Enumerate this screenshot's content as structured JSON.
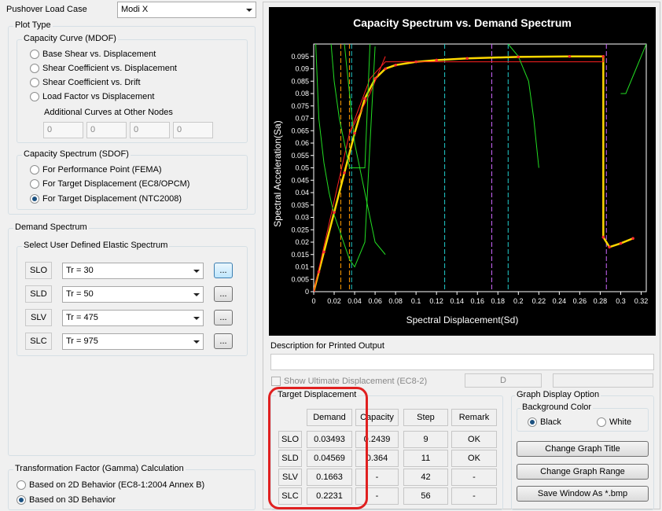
{
  "pushover": {
    "label": "Pushover Load Case",
    "value": "Modi X"
  },
  "plot_type": {
    "title": "Plot Type",
    "mdof": {
      "title": "Capacity Curve (MDOF)",
      "options": [
        "Base Shear vs. Displacement",
        "Shear Coefficient vs. Displacement",
        "Shear Coefficient vs. Drift",
        "Load Factor vs Displacement"
      ],
      "additional_label": "Additional Curves at Other Nodes",
      "nodes": [
        "0",
        "0",
        "0",
        "0"
      ]
    },
    "sdof": {
      "title": "Capacity Spectrum (SDOF)",
      "options": [
        "For Performance Point (FEMA)",
        "For Target Displacement (EC8/OPCM)",
        "For Target Displacement (NTC2008)"
      ],
      "selected_index": 2
    }
  },
  "demand": {
    "title": "Demand Spectrum",
    "subtitle": "Select User Defined Elastic Spectrum",
    "rows": [
      {
        "level": "SLO",
        "value": "Tr = 30",
        "btn": "..."
      },
      {
        "level": "SLD",
        "value": "Tr = 50",
        "btn": "..."
      },
      {
        "level": "SLV",
        "value": "Tr = 475",
        "btn": "..."
      },
      {
        "level": "SLC",
        "value": "Tr = 975",
        "btn": "..."
      }
    ]
  },
  "gamma": {
    "title": "Transformation Factor (Gamma) Calculation",
    "options": [
      "Based on 2D Behavior (EC8-1:2004  Annex B)",
      "Based on 3D Behavior"
    ],
    "selected_index": 1
  },
  "chart_data": {
    "type": "line",
    "title": "Capacity Spectrum vs. Demand Spectrum",
    "xlabel": "Spectral Displacement(Sd)",
    "ylabel": "Spectral Acceleration(Sa)",
    "xlim": [
      0,
      0.325
    ],
    "ylim": [
      0,
      0.1
    ],
    "xticks": [
      "0",
      "0.02",
      "0.04",
      "0.06",
      "0.08",
      "0.1",
      "0.12",
      "0.14",
      "0.16",
      "0.18",
      "0.2",
      "0.22",
      "0.24",
      "0.26",
      "0.28",
      "0.3",
      "0.32"
    ],
    "yticks": [
      "0",
      "0.005",
      "0.01",
      "0.015",
      "0.02",
      "0.025",
      "0.03",
      "0.035",
      "0.04",
      "0.045",
      "0.05",
      "0.055",
      "0.06",
      "0.065",
      "0.07",
      "0.075",
      "0.08",
      "0.085",
      "0.09",
      "0.095"
    ],
    "background": "#000000",
    "series": [
      {
        "color": "#ffd700",
        "x": [
          0,
          0.005,
          0.01,
          0.02,
          0.03,
          0.04,
          0.05,
          0.06,
          0.07,
          0.08,
          0.1,
          0.12,
          0.15,
          0.2,
          0.25,
          0.283,
          0.283,
          0.289,
          0.3,
          0.312
        ],
        "y": [
          0,
          0.008,
          0.016,
          0.032,
          0.048,
          0.064,
          0.078,
          0.086,
          0.09,
          0.0915,
          0.0928,
          0.0935,
          0.0942,
          0.0948,
          0.095,
          0.095,
          0.022,
          0.018,
          0.0195,
          0.0215
        ]
      },
      {
        "color": "#ff2020",
        "x": [
          0,
          0.035,
          0.055,
          0.07,
          0.283,
          0.283
        ],
        "y": [
          0,
          0.064,
          0.086,
          0.0928,
          0.0928,
          0.095
        ]
      },
      {
        "color": "#ff2020",
        "x": [
          0.035,
          0.055,
          0.07
        ],
        "y": [
          0.064,
          0.08,
          0.095
        ]
      },
      {
        "color": "#22dd22",
        "x": [
          0.002,
          0.005,
          0.01,
          0.015,
          0.02,
          0.025,
          0.03,
          0.035,
          0.04,
          0.05,
          0.06
        ],
        "y": [
          0.1,
          0.07,
          0.052,
          0.04,
          0.031,
          0.025,
          0.019,
          0.013,
          0.01,
          0.02,
          0.099
        ]
      },
      {
        "color": "#22dd22",
        "x": [
          0.017,
          0.02,
          0.025,
          0.03,
          0.035,
          0.04,
          0.05,
          0.055
        ],
        "y": [
          0.1,
          0.085,
          0.07,
          0.06,
          0.05,
          0.05,
          0.05,
          0.1
        ]
      },
      {
        "color": "#22dd22",
        "x": [
          0.03,
          0.04,
          0.05,
          0.06,
          0.07
        ],
        "y": [
          0.1,
          0.06,
          0.04,
          0.02,
          0.015
        ]
      },
      {
        "color": "#22dd22",
        "x": [
          0.19,
          0.2,
          0.21,
          0.215,
          0.22
        ],
        "y": [
          0.1,
          0.095,
          0.085,
          0.07,
          0.05
        ]
      },
      {
        "color": "#22dd22",
        "x": [
          0.3,
          0.305,
          0.315,
          0.325
        ],
        "y": [
          0.08,
          0.08,
          0.09,
          0.1
        ]
      }
    ],
    "target_lines": [
      {
        "x": 0.0265,
        "color": "#ff9900"
      },
      {
        "x": 0.0349,
        "color": "#ff9900"
      },
      {
        "x": 0.128,
        "color": "#22cccc"
      },
      {
        "x": 0.174,
        "color": "#cc66ff"
      },
      {
        "x": 0.19,
        "color": "#22cccc"
      },
      {
        "x": 0.286,
        "color": "#cc66ff"
      },
      {
        "x": 0.037,
        "color": "#22cccc"
      }
    ]
  },
  "description": {
    "label": "Description for Printed Output",
    "value": ""
  },
  "ultimate": {
    "label": "Show Ultimate Displacement  (EC8-2)",
    "d_value": "D",
    "extra": ""
  },
  "target": {
    "title": "Target Displacement",
    "headers": [
      "Demand",
      "Capacity",
      "Step",
      "Remark"
    ],
    "rows": [
      {
        "level": "SLO",
        "demand": "0.03493",
        "capacity": "0.2439",
        "step": "9",
        "remark": "OK"
      },
      {
        "level": "SLD",
        "demand": "0.04569",
        "capacity": "0.364",
        "step": "11",
        "remark": "OK"
      },
      {
        "level": "SLV",
        "demand": "0.1663",
        "capacity": "-",
        "step": "42",
        "remark": "-"
      },
      {
        "level": "SLC",
        "demand": "0.2231",
        "capacity": "-",
        "step": "56",
        "remark": "-"
      }
    ]
  },
  "graph_options": {
    "title": "Graph Display Option",
    "bg_title": "Background Color",
    "bg_options": [
      "Black",
      "White"
    ],
    "bg_selected": 0,
    "buttons": [
      "Change Graph Title",
      "Change Graph Range",
      "Save Window As *.bmp"
    ]
  }
}
